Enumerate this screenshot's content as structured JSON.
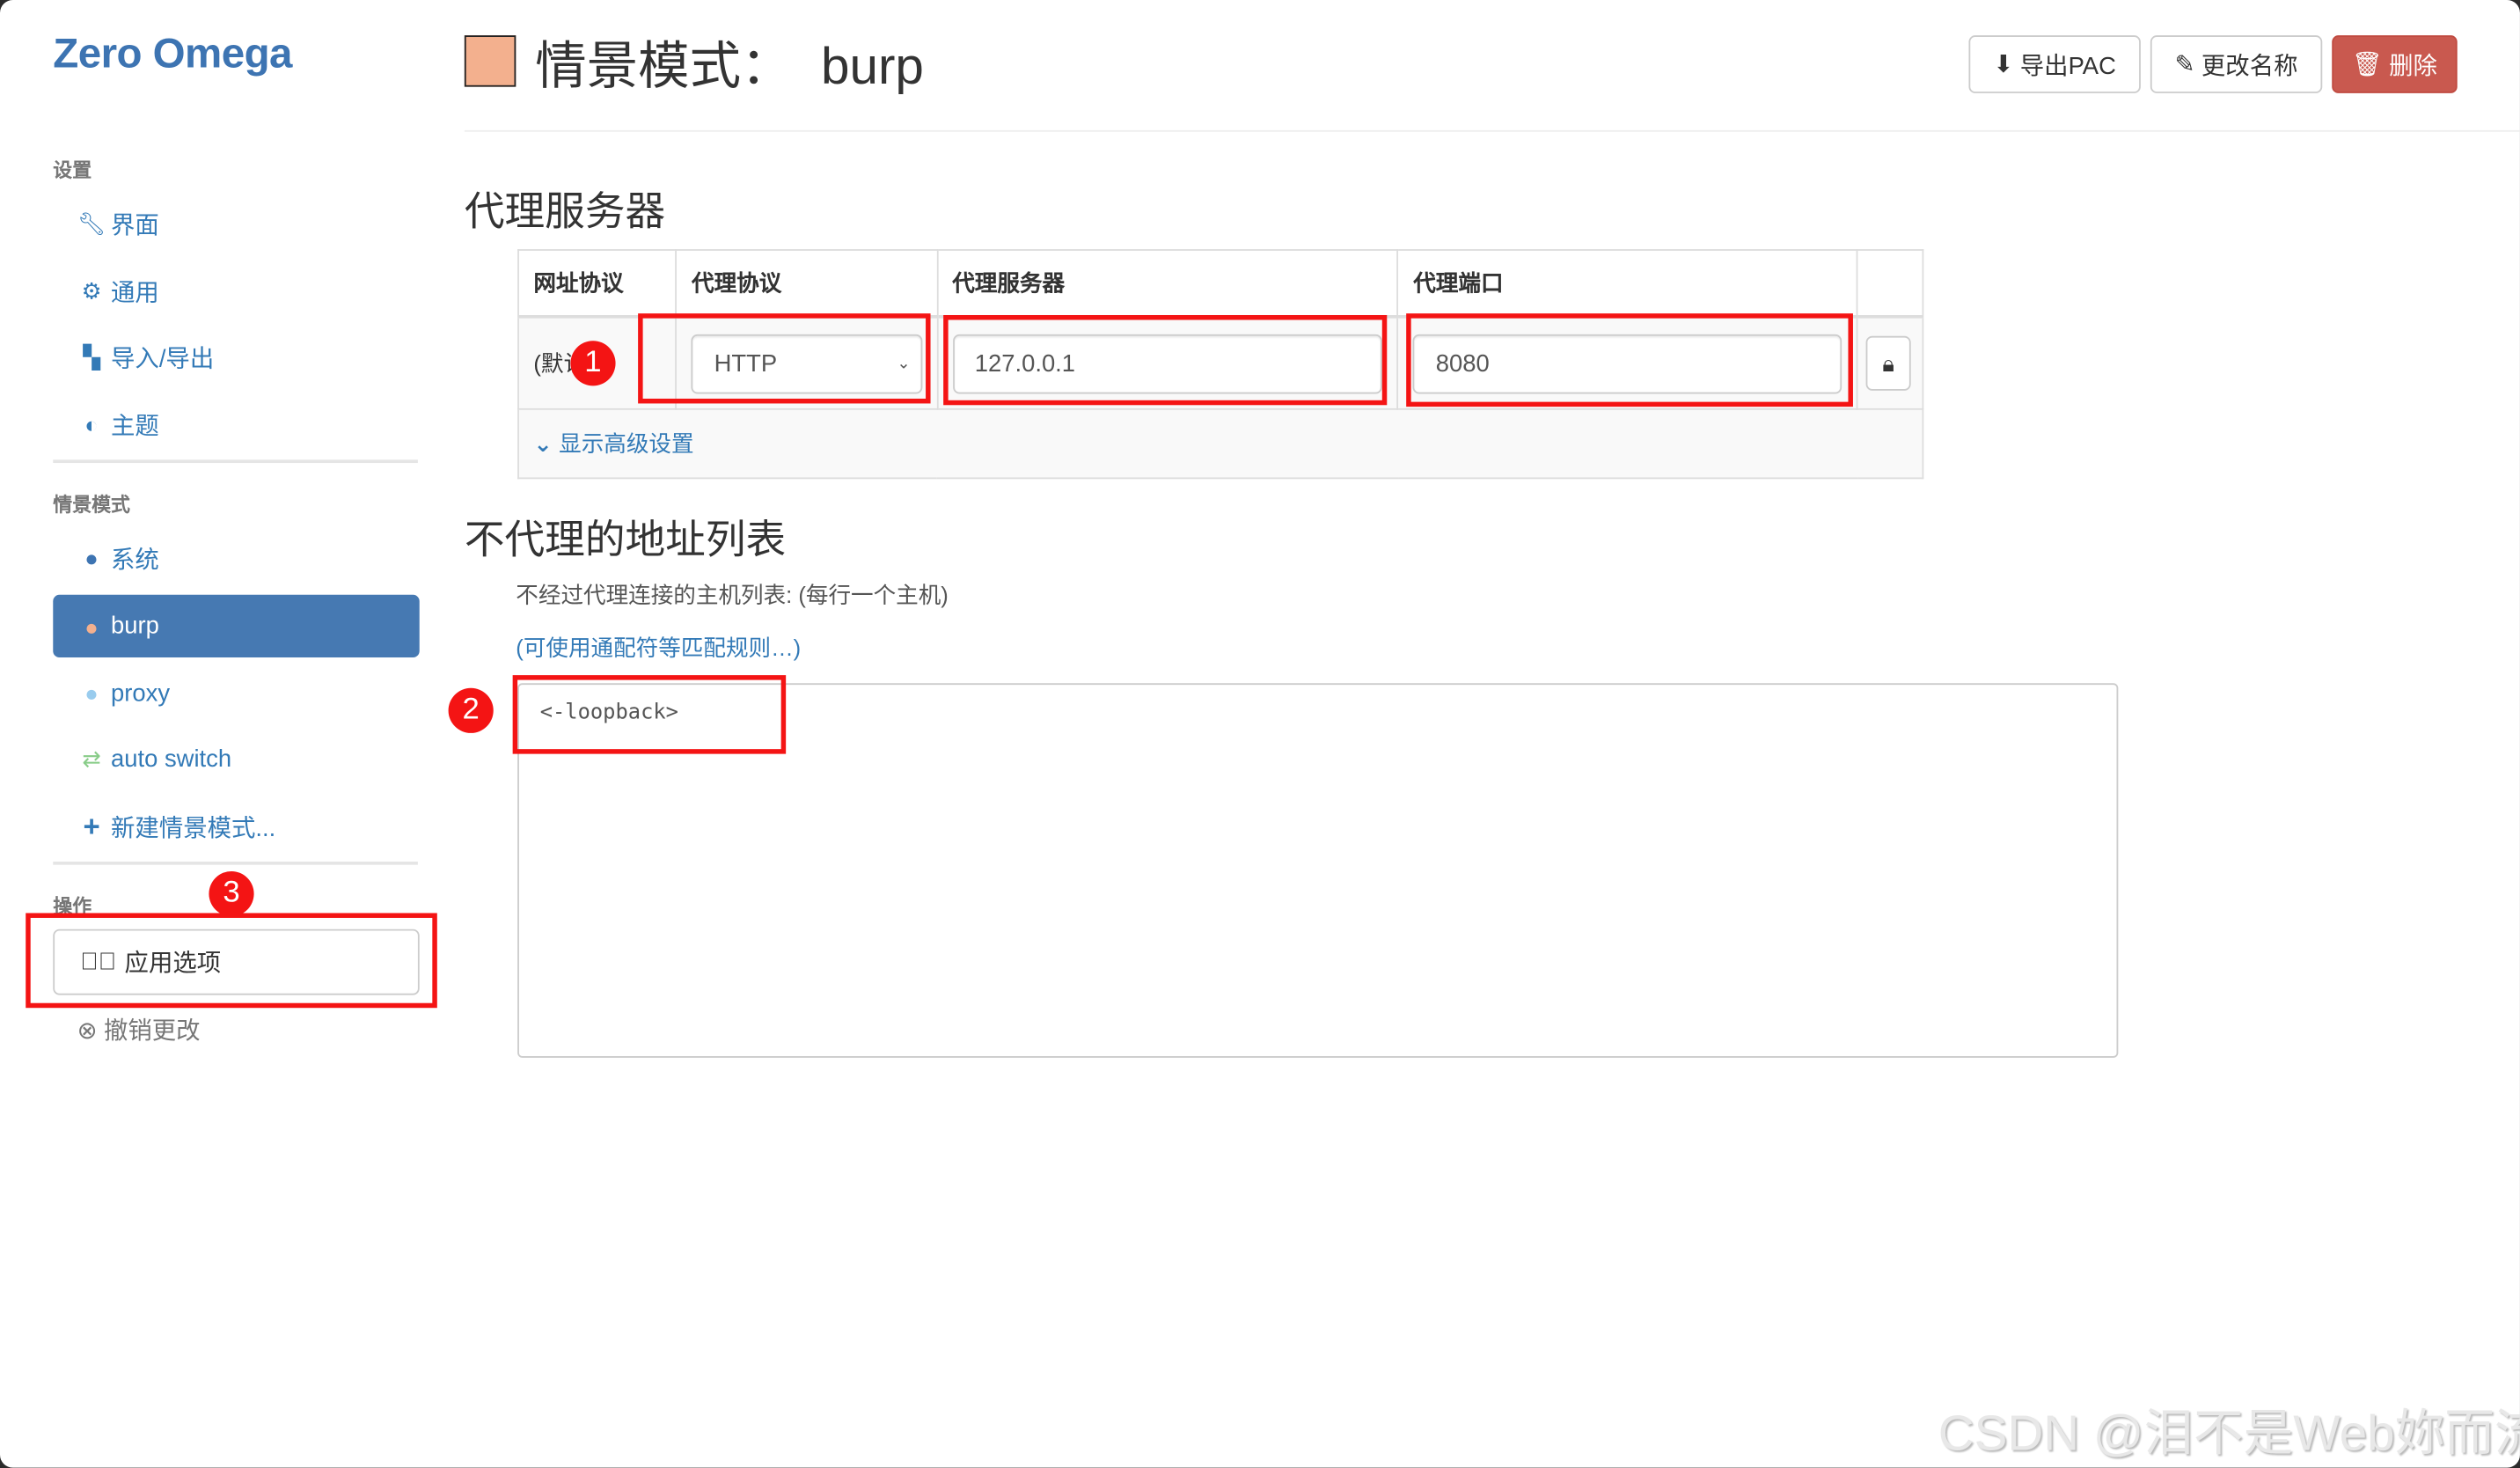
{
  "app_title": "Zero Omega",
  "sidebar": {
    "settings_header": "设置",
    "settings_items": [
      {
        "label": "界面",
        "icon": "wrench-icon"
      },
      {
        "label": "通用",
        "icon": "gear-icon"
      },
      {
        "label": "导入/导出",
        "icon": "floppy-icon"
      },
      {
        "label": "主题",
        "icon": "contrast-icon"
      }
    ],
    "profiles_header": "情景模式",
    "profiles": [
      {
        "label": "系统",
        "icon": "globe-icon",
        "color": "#3d74b2"
      },
      {
        "label": "burp",
        "icon": "globe-icon",
        "color": "#f3b08e",
        "active": true
      },
      {
        "label": "proxy",
        "icon": "globe-icon",
        "color": "#99ccee"
      },
      {
        "label": "auto switch",
        "icon": "retweet-icon",
        "color": "#99dd99"
      },
      {
        "label": "新建情景模式...",
        "icon": "plus-icon"
      }
    ],
    "actions_header": "操作",
    "apply_label": "应用选项",
    "revert_label": "撤销更改"
  },
  "header": {
    "profile_color": "#f3b08e",
    "title": "情景模式：  burp",
    "export_pac": "导出PAC",
    "rename": "更改名称",
    "delete": "删除"
  },
  "proxy_servers": {
    "heading": "代理服务器",
    "columns": [
      "网址协议",
      "代理协议",
      "代理服务器",
      "代理端口"
    ],
    "row": {
      "scheme": "(默认)",
      "protocol": "HTTP",
      "server": "127.0.0.1",
      "port": "8080"
    },
    "advanced_link": "显示高级设置"
  },
  "bypass": {
    "heading": "不代理的地址列表",
    "description": "不经过代理连接的主机列表: (每行一个主机)",
    "wildcard_link": "(可使用通配符等匹配规则…)",
    "value": "<-loopback>"
  },
  "annotations": [
    "1",
    "2",
    "3"
  ],
  "watermark": "CSDN @泪不是Web妳而流",
  "colors": {
    "accent": "#337ab7",
    "active": "#4679b2",
    "danger": "#c9594f",
    "annotation": "#f41414"
  }
}
